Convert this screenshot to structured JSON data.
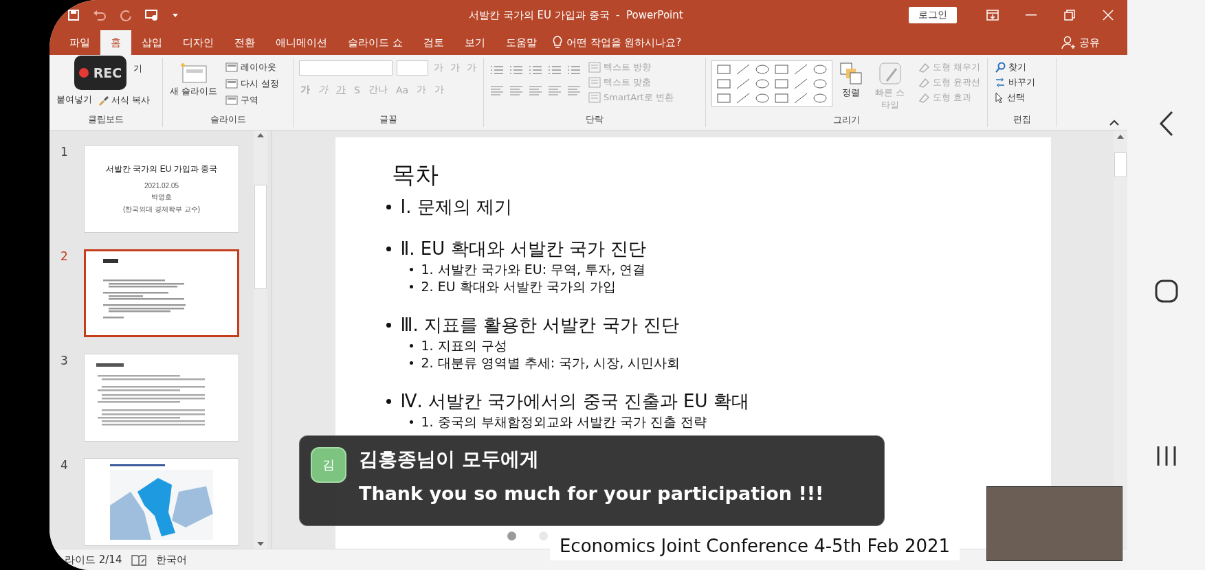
{
  "title_bar": {
    "title": "서발칸 국가의 EU 가입과 중국  -  PowerPoint",
    "login": "로그인"
  },
  "tabs": [
    {
      "label": "파일",
      "selected": false
    },
    {
      "label": "홈",
      "selected": true
    },
    {
      "label": "삽입",
      "selected": false
    },
    {
      "label": "디자인",
      "selected": false
    },
    {
      "label": "전환",
      "selected": false
    },
    {
      "label": "애니메이션",
      "selected": false
    },
    {
      "label": "슬라이드 쇼",
      "selected": false
    },
    {
      "label": "검토",
      "selected": false
    },
    {
      "label": "보기",
      "selected": false
    },
    {
      "label": "도움말",
      "selected": false
    }
  ],
  "tell_me": "어떤 작업을 원하시나요?",
  "share": "공유",
  "ribbon": {
    "clipboard": {
      "label": "클립보드",
      "paste": "붙여넣기",
      "cut": "기",
      "format_painter": "서식 복사"
    },
    "slides": {
      "label": "슬라이드",
      "new_slide": "새 슬라이드",
      "commands": [
        "레이아웃",
        "다시 설정",
        "구역"
      ]
    },
    "font": {
      "label": "글꼴",
      "size_buttons": [
        {
          "label": "가",
          "disabled": true
        },
        {
          "label": "가",
          "disabled": true
        },
        {
          "label": "가",
          "disabled": true
        }
      ],
      "format_buttons": [
        {
          "label": "가",
          "kind": "bold",
          "disabled": true
        },
        {
          "label": "가",
          "kind": "italic",
          "disabled": true
        },
        {
          "label": "가",
          "kind": "underline",
          "disabled": true
        },
        {
          "label": "S",
          "kind": "shadow",
          "disabled": true
        },
        {
          "label": "간나",
          "kind": "spacing",
          "disabled": true
        },
        {
          "label": "Aa",
          "kind": "case",
          "disabled": true
        },
        {
          "label": "가",
          "kind": "highlight",
          "disabled": true
        },
        {
          "label": "가",
          "kind": "color",
          "disabled": true
        }
      ]
    },
    "paragraph": {
      "label": "단락",
      "text_commands": [
        {
          "label": "텍스트 방향",
          "disabled": true
        },
        {
          "label": "텍스트 맞춤",
          "disabled": true
        },
        {
          "label": "SmartArt로 변환",
          "disabled": true
        }
      ]
    },
    "drawing": {
      "label": "그리기",
      "arrange": "정렬",
      "quick_styles": {
        "label": "빠른 스타일",
        "disabled": true
      },
      "shape_commands": [
        {
          "label": "도형 채우기",
          "disabled": true
        },
        {
          "label": "도형 윤곽선",
          "disabled": true
        },
        {
          "label": "도형 효과",
          "disabled": true
        }
      ]
    },
    "editing": {
      "label": "편집",
      "commands": [
        "찾기",
        "바꾸기",
        "선택"
      ]
    }
  },
  "rec": "REC",
  "thumbnails": [
    {
      "number": "1",
      "selected": false,
      "kind": "title",
      "title": "서발칸 국가의 EU 가입과 중국",
      "date": "2021.02.05",
      "author": "박영호",
      "affiliation": "(한국외대 경제학부 교수)"
    },
    {
      "number": "2",
      "selected": true,
      "kind": "outline"
    },
    {
      "number": "3",
      "selected": false,
      "kind": "text"
    },
    {
      "number": "4",
      "selected": false,
      "kind": "map"
    }
  ],
  "slide": {
    "title": "목차",
    "items": [
      {
        "text": "Ⅰ. 문제의 제기"
      },
      {
        "text": "Ⅱ. EU 확대와 서발칸 국가 진단",
        "children": [
          {
            "text": "1. 서발칸 국가와 EU: 무역, 투자, 연결"
          },
          {
            "text": "2. EU 확대와 서발칸 국가의 가입"
          }
        ]
      },
      {
        "text": "Ⅲ. 지표를 활용한 서발칸 국가 진단",
        "children": [
          {
            "text": "1. 지표의 구성"
          },
          {
            "text": "2. 대분류 영역별 추세: 국가, 시장, 시민사회"
          }
        ]
      },
      {
        "text": "Ⅳ. 서발칸 국가에서의 중국 진출과 EU 확대",
        "children": [
          {
            "text": "1. 중국의 부채함정외교와 서발칸 국가 진출 전략"
          }
        ]
      }
    ]
  },
  "chat_toast": {
    "avatar": "김",
    "sender": "김흥종님이 모두에게",
    "message": "Thank you so much for your participation !!!"
  },
  "pager": [
    {
      "selected": true
    },
    {
      "selected": false
    }
  ],
  "caption": "Economics Joint Conference 4-5th Feb 2021",
  "status_bar": {
    "slide_count": "라이드 2/14",
    "language": "한국어"
  }
}
